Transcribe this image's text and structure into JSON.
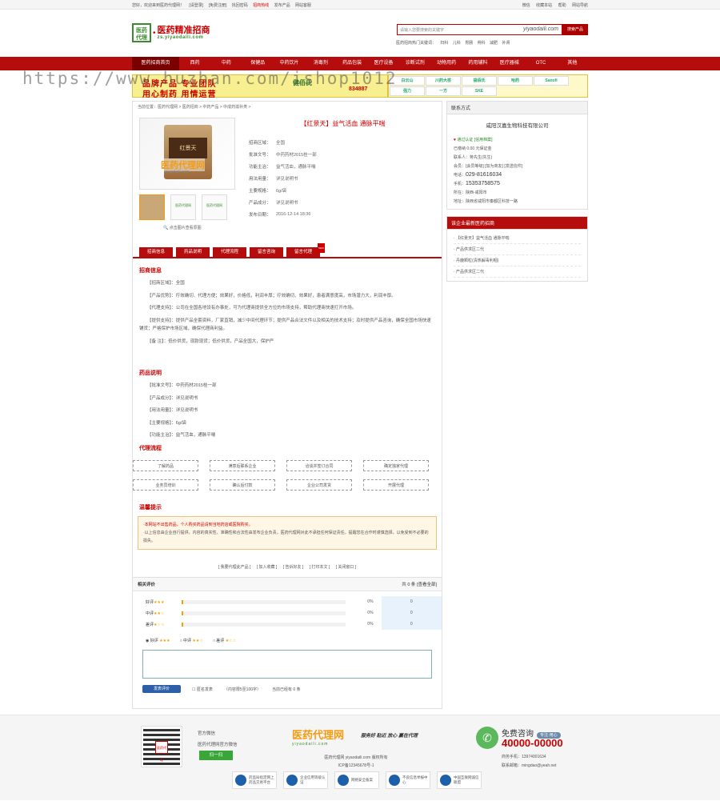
{
  "topbar": {
    "left": [
      "您好，欢迎来到医药代理网！",
      "[请登录]",
      "[免费注册]",
      "找回密码",
      "发布产品",
      "网站客服"
    ],
    "red": "招商热线",
    "right": [
      "微信",
      "收藏本站",
      "帮助",
      "网站导航"
    ]
  },
  "logo": {
    "mark": "医药\n代理",
    "title": "医药精准招商",
    "sub": "zs.yiyaodaili.com"
  },
  "search": {
    "placeholder": "请输入您要搜索的关键字",
    "watermark": "yiyaodaili.com",
    "button": "搜索产品"
  },
  "hot": {
    "label": "医药招商热门关键词：",
    "items": [
      "妇科",
      "儿科",
      "胃肠",
      "骨科",
      "减肥",
      "补肾"
    ]
  },
  "nav": [
    "医药招商首页",
    "西药",
    "中药",
    "保健品",
    "中药饮片",
    "消毒剂",
    "药品包装",
    "医疗设备",
    "诊断试剂",
    "动物用药",
    "药用辅料",
    "医疗器械",
    "OTC",
    "其他"
  ],
  "banner": {
    "t1": "品牌产品 专业团队",
    "t2": "用心制药 用情运营",
    "brand": "健佰氏",
    "tel": "834887",
    "brands": [
      "白云山",
      "川药大核",
      "福佰氏",
      "哈药",
      "Sanofi",
      "强力",
      "一方",
      "SKE"
    ]
  },
  "url_watermark": "https://www.huzhan.com/ishop1012",
  "crumb": "当前位置：医药代理网 > 医药招商 > 中药产品 > 中成药滋补类 >",
  "product": {
    "title": "【红景天】益气活血 通脉平喘",
    "pack_name": "红景天",
    "img_wm": "医药代理网",
    "img_url": "yiyaodaili.com",
    "rows": [
      {
        "k": "招商区域：",
        "v": "全国"
      },
      {
        "k": "批准文号：",
        "v": "中药药材2015桂一部"
      },
      {
        "k": "功能主治：",
        "v": "益气活血，通脉平喘"
      },
      {
        "k": "用法用量：",
        "v": "详见说明书"
      },
      {
        "k": "主要规格：",
        "v": "6g/袋"
      },
      {
        "k": "产品成分：",
        "v": "详见说明书"
      },
      {
        "k": "发布日期：",
        "v": "2016-12-14 18:36"
      }
    ],
    "thumbs": [
      "",
      "医药代理网",
      "医药代理网"
    ],
    "zoom": "点击图片查看原图"
  },
  "tabs": [
    "招商信息",
    "药品说明",
    "代理流程",
    "留言咨询",
    "留言代理"
  ],
  "tab_new": "NEW",
  "sec1": {
    "title": "招商信息",
    "paras": [
      "【招商区域】：全国",
      "【产品优势】：疗效确切、代理方便；效果好，价格低，利润丰厚；疗效确切、效果好，患者满意度高，市场潜力大，利润丰厚。",
      "【代理支持】：公司在全国各地设有办事处，可为代理商提供全方位的市场支持，帮助代理商快速打开市场。",
      "【提供支持】：提供产品全套资料，厂家直销，减少中间代理环节；提供产品合法文件以及相关的技术支持；及时提供产品咨询，确保全国市场快速铺货；严格保护市场区域，确保代理商利益。",
      "【备 注】：低价供货，现款现货；低价供货，产品全国大，保护严"
    ]
  },
  "sec2": {
    "title": "药品说明",
    "paras": [
      "【批准文号】：中药药材2015桂一部",
      "【产品成分】：详见说明书",
      "【用法用量】：详见说明书",
      "【主要规格】：6g/袋",
      "【功能主治】：益气活血，通脉平喘"
    ]
  },
  "sec3": {
    "title": "代理流程",
    "boxes": [
      "了解药品",
      "满意后联系企业",
      "洽谈并签订合同",
      "确定独家代理",
      "业务员培训",
      "确认后付款",
      "企业公司发货",
      "开展代理"
    ]
  },
  "sec4": {
    "title": "温馨提示",
    "l1": "·本网站不出售药品，个人购买药品请到当地药店或医院购买。",
    "l2": "·以上信息由企业自行提供，内容的真实性、准确性和合法性由发布企业负责，医药代理网对此不承担任何保证责任。提醒您在合作时谨慎选择，以免受到不必要的损失。"
  },
  "links": [
    "[ 我要代理此产品 ]",
    "[ 加入收藏 ]",
    "[ 告诉好友 ]",
    "[ 打印本文 ]",
    "[ 关闭窗口 ]"
  ],
  "review": {
    "title": "相关评价",
    "summary": "共 0 条 [查看全部]",
    "rows": [
      {
        "lbl": "好评",
        "stars": "★★★",
        "pct": "0%",
        "cnt": "0"
      },
      {
        "lbl": "中评",
        "stars": "★★☆",
        "pct": "0%",
        "cnt": "0"
      },
      {
        "lbl": "差评",
        "stars": "★☆☆",
        "pct": "0%",
        "cnt": "0"
      }
    ],
    "radios": [
      {
        "lbl": "好评",
        "st": "★★★"
      },
      {
        "lbl": "中评",
        "st": "★★☆"
      },
      {
        "lbl": "差评",
        "st": "★☆☆"
      }
    ],
    "submit": "发表评价",
    "anon": "匿名发表",
    "hint": "（内容限5至100字）",
    "online": "当前已经有 0 条"
  },
  "side": {
    "contact_title": "联系方式",
    "company": "咸阳汉嘉生物科技有限公司",
    "verify": "通过认证 [信用档案]",
    "years": "已缴纳 0.00 元保证金",
    "person": "联系人：蒋先生(先生)",
    "member": "会员：[会员等级] [加为商友] [发送信件]",
    "tel_k": "电话：",
    "tel": "029-81616034",
    "mob_k": "手机：",
    "mob": "15353758575",
    "addr": "所在：陕西-咸阳市",
    "company_addr": "地址：陕西省咸阳市秦都区科技一路",
    "list_title": "该企业最新医药招商",
    "list": [
      "【红景天】益气活血 通脉平喘",
      "产品供求区二代",
      "丹鹿颗粒(清热解毒利咽)",
      "产品供求区二代"
    ]
  },
  "footer": {
    "qr_label": "医药代理",
    "wx_title": "官方微信",
    "wx_desc": "医药代理网官方微信",
    "wx_btn": "扫一扫",
    "logo": "医药代理网",
    "logo_url": "yiyaodaili.com",
    "slogan": "服务好 贴近 放心 赢在代理",
    "copy1": "医药代理网 yiyaodaili.com 版权所有",
    "copy2": "ICP备12345678号-1",
    "call": "免费咨询",
    "call_tag": "专注·用心",
    "hotline": "40000-00000",
    "mobile": "商务手机：13974001634",
    "email": "联系邮箱：mingdao@yeah.net",
    "badges": [
      "药监局指定网上药品交易平台",
      "企业信用等级认证",
      "网络安全备案",
      "不良信息举报中心",
      "中国互联网诚信联盟"
    ]
  }
}
